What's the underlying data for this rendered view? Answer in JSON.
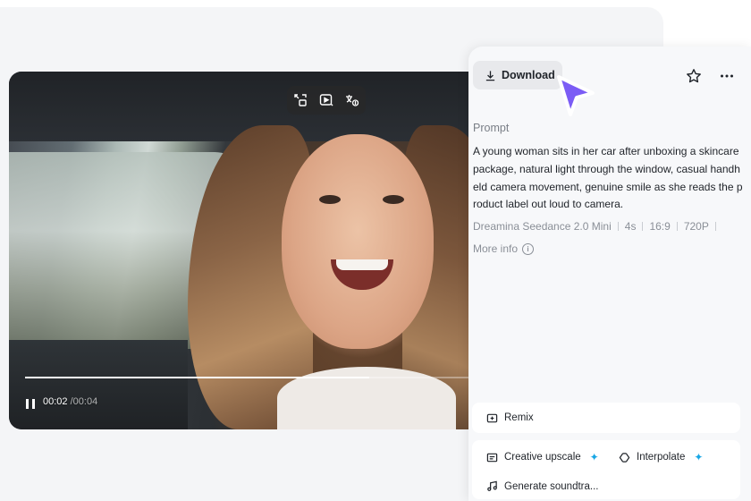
{
  "player": {
    "current_time": "00:02",
    "separator": "/",
    "total_time": "00:04",
    "progress_fraction": 0.74,
    "toolbar_icons": [
      "picture-in-picture-icon",
      "video-edit-icon",
      "translate-icon"
    ]
  },
  "panel": {
    "download_label": "Download",
    "prompt_label": "Prompt",
    "prompt_text": "A young woman sits in her car after unboxing a skincare package, natural light through the window, casual handheld camera movement, genuine smile as she reads the product label out loud to camera.",
    "meta": [
      "Dreamina Seedance 2.0 Mini",
      "4s",
      "16:9",
      "720P"
    ],
    "more_info_label": "More info",
    "remix_label": "Remix",
    "creative_upscale_label": "Creative upscale",
    "interpolate_label": "Interpolate",
    "generate_soundtrack_label": "Generate soundtra...",
    "sparkle_symbol": "✦"
  },
  "colors": {
    "accent_sparkle": "#19a7e5",
    "cursor": "#7b5cf5"
  }
}
